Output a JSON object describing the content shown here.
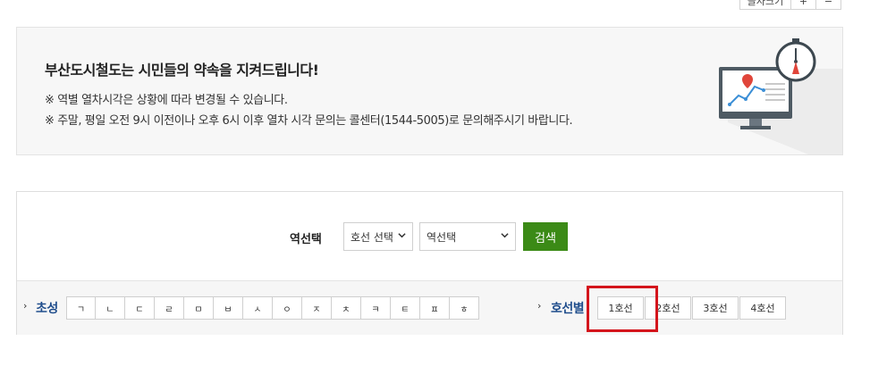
{
  "font_size_control": {
    "label": "글자크기",
    "plus": "+",
    "minus": "−"
  },
  "notice": {
    "title": "부산도시철도는 시민들의 약속을 지켜드립니다!",
    "lines": [
      "※ 역별 열차시각은 상황에 따라 변경될 수 있습니다.",
      "※ 주말, 평일 오전 9시 이전이나 오후 6시 이후 열차 시각 문의는 콜센터(1544-5005)로 문의해주시기 바랍니다."
    ]
  },
  "search": {
    "label": "역선택",
    "line_select": "호선 선택",
    "station_select": "역선택",
    "button": "검색",
    "button_color": "#3b8a16"
  },
  "filter": {
    "arrow": "›",
    "chosung_label": "초성",
    "chosung": [
      "ㄱ",
      "ㄴ",
      "ㄷ",
      "ㄹ",
      "ㅁ",
      "ㅂ",
      "ㅅ",
      "ㅇ",
      "ㅈ",
      "ㅊ",
      "ㅋ",
      "ㅌ",
      "ㅍ",
      "ㅎ"
    ],
    "line_label": "호선별",
    "lines": [
      "1호선",
      "2호선",
      "3호선",
      "4호선"
    ],
    "highlight_color": "#d4151c"
  }
}
